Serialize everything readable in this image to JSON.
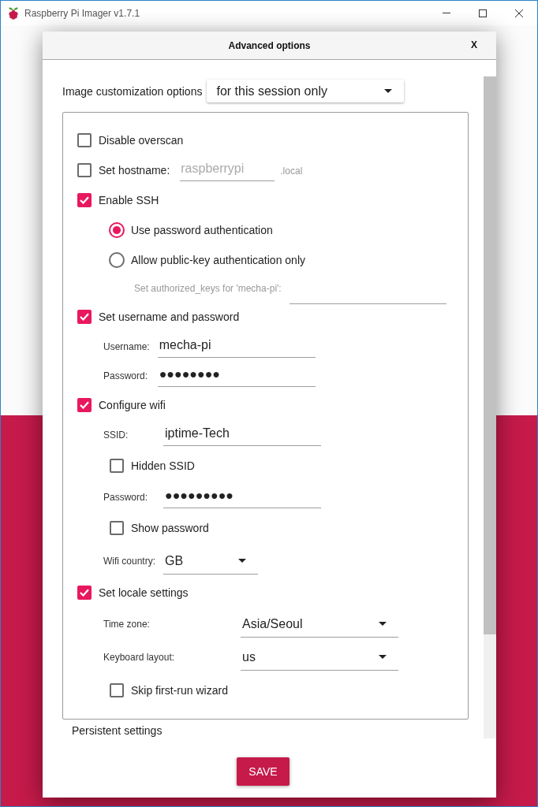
{
  "window": {
    "title": "Raspberry Pi Imager v1.7.1"
  },
  "dialog": {
    "title": "Advanced options",
    "close_label": "X",
    "customization": {
      "label": "Image customization options",
      "value": "for this session only"
    },
    "options": [
      {
        "kind": "checkbox",
        "label": "Disable overscan",
        "checked": false
      },
      {
        "kind": "checkbox",
        "label": "Set hostname:",
        "checked": false,
        "field": {
          "placeholder": "raspberrypi",
          "suffix": ".local"
        }
      },
      {
        "kind": "checkbox",
        "label": "Enable SSH",
        "checked": true,
        "children": [
          {
            "kind": "radio",
            "label": "Use password authentication",
            "selected": true
          },
          {
            "kind": "radio",
            "label": "Allow public-key authentication only",
            "selected": false
          },
          {
            "kind": "subfield",
            "label": "Set authorized_keys for 'mecha-pi':"
          }
        ]
      },
      {
        "kind": "checkbox",
        "label": "Set username and password",
        "checked": true,
        "children": [
          {
            "kind": "field",
            "label": "Username:",
            "value": "mecha-pi"
          },
          {
            "kind": "field",
            "label": "Password:",
            "value": "●●●●●●●●"
          }
        ]
      },
      {
        "kind": "checkbox",
        "label": "Configure wifi",
        "checked": true,
        "children": [
          {
            "kind": "field",
            "label": "SSID:",
            "value": "iptime-Tech"
          },
          {
            "kind": "checkbox",
            "label": "Hidden SSID",
            "checked": false
          },
          {
            "kind": "field",
            "label": "Password:",
            "value": "●●●●●●●●●"
          },
          {
            "kind": "checkbox",
            "label": "Show password",
            "checked": false
          },
          {
            "kind": "dropdown",
            "label": "Wifi country:",
            "value": "GB"
          }
        ]
      },
      {
        "kind": "checkbox",
        "label": "Set locale settings",
        "checked": true,
        "children": [
          {
            "kind": "dropdown",
            "label": "Time zone:",
            "value": "Asia/Seoul"
          },
          {
            "kind": "dropdown",
            "label": "Keyboard layout:",
            "value": "us"
          },
          {
            "kind": "checkbox",
            "label": "Skip first-run wizard",
            "checked": false
          }
        ]
      }
    ],
    "persistent_settings": {
      "label": "Persistent settings"
    },
    "save_button": {
      "label": "SAVE"
    }
  }
}
